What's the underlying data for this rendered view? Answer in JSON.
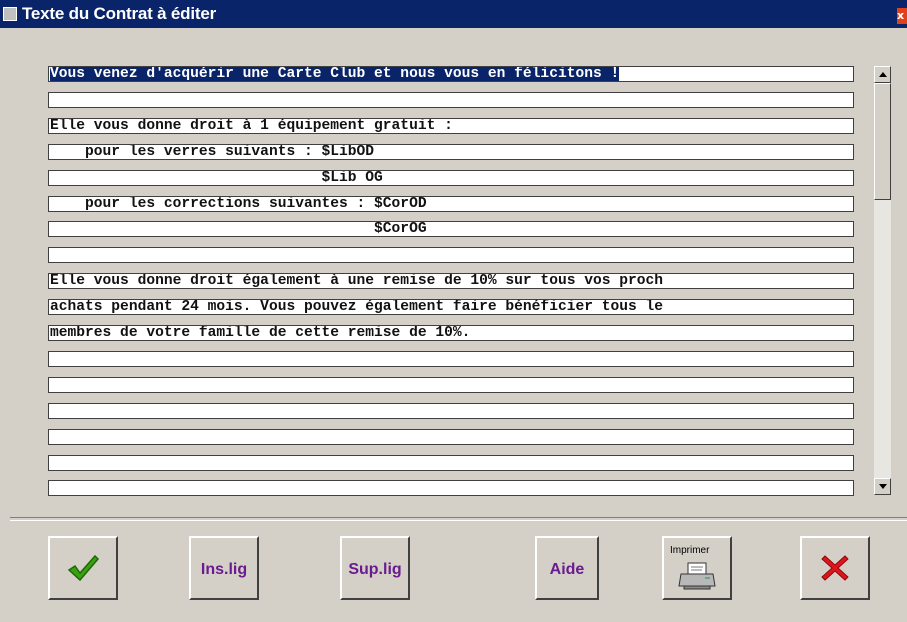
{
  "window": {
    "title": "Texte du Contrat à éditer",
    "close_label": "x"
  },
  "editor": {
    "lines": [
      "Vous venez d'acquérir une Carte Club et nous vous en félicitons !",
      "",
      "Elle vous donne droit à 1 équipement gratuit :",
      "    pour les verres suivants : $LibOD",
      "                               $Lib OG",
      "    pour les corrections suivantes : $CorOD",
      "                                     $CorOG",
      "",
      "Elle vous donne droit également à une remise de 10% sur tous vos proch",
      "achats pendant 24 mois. Vous pouvez également faire bénéficier tous le",
      "membres de votre famille de cette remise de 10%.",
      "",
      "",
      "",
      "",
      "",
      ""
    ]
  },
  "buttons": {
    "ok_icon": "checkmark-icon",
    "ins_label": "Ins.lig",
    "sup_label": "Sup.lig",
    "aide_label": "Aide",
    "print_label": "Imprimer",
    "print_icon": "printer-icon",
    "cancel_icon": "cross-icon"
  },
  "colors": {
    "title_bar": "#0a246a",
    "label_text": "#6a1b8f",
    "check": "#3aa010",
    "cross": "#e0141c"
  }
}
